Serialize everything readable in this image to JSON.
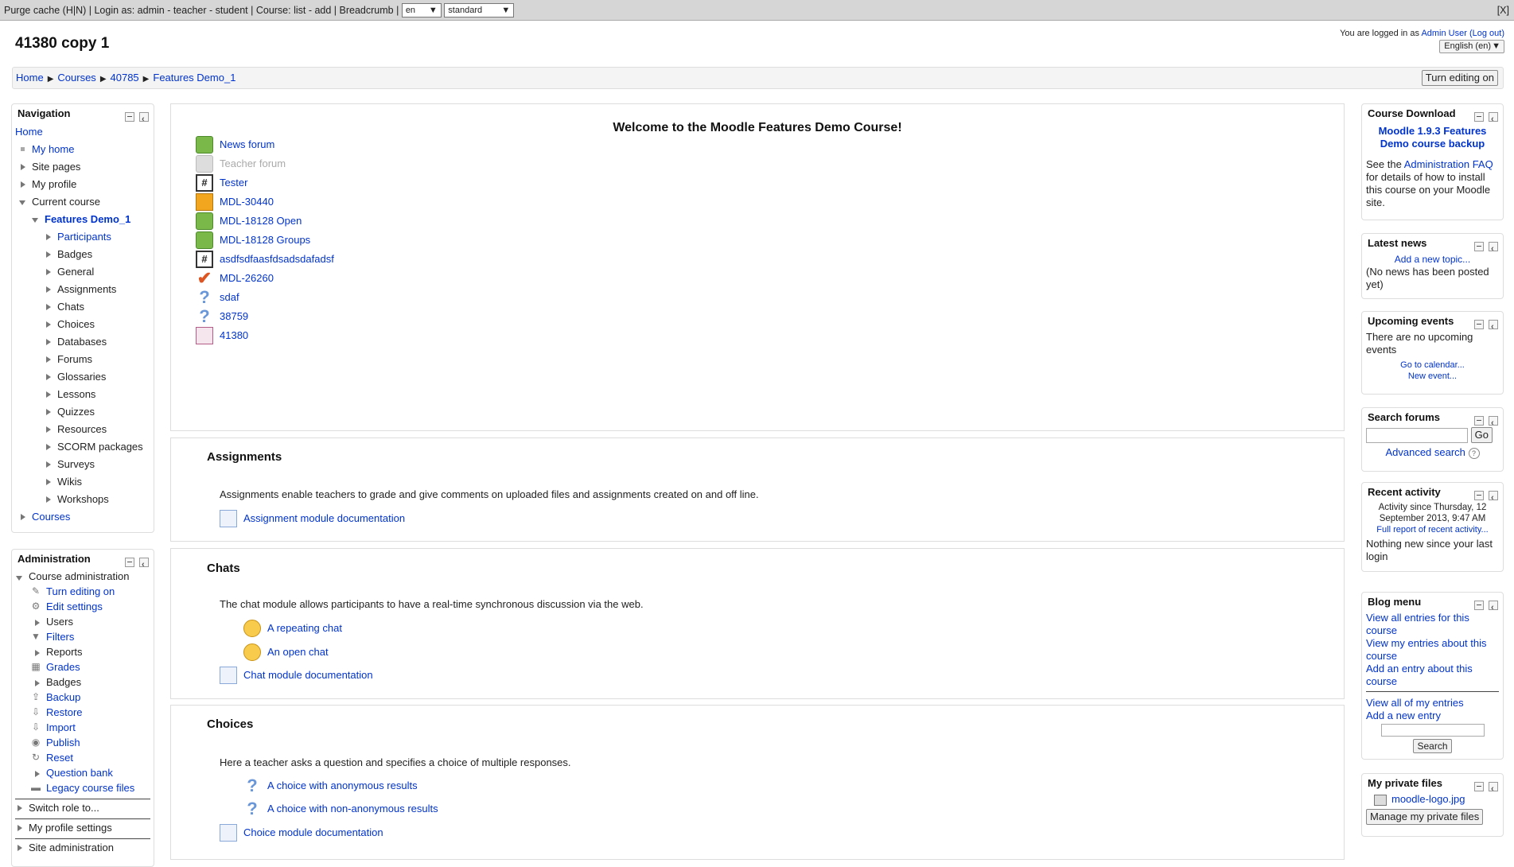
{
  "devbar": {
    "text": "Purge cache (H|N) | Login as: admin - teacher - student | Course: list - add | Breadcrumb |",
    "lang_select": "en",
    "theme_select": "standard",
    "close": "[X]"
  },
  "header": {
    "title": "41380 copy 1",
    "logged_in_prefix": "You are logged in as",
    "user": "Admin User",
    "logout": "(Log out)",
    "language": "English (en)"
  },
  "breadcrumb": [
    "Home",
    "Courses",
    "40785",
    "Features Demo_1"
  ],
  "edit_button": "Turn editing on",
  "navigation": {
    "title": "Navigation",
    "home": "Home",
    "items": [
      "My home",
      "Site pages",
      "My profile",
      "Current course"
    ],
    "course": "Features Demo_1",
    "course_items": [
      "Participants",
      "Badges",
      "General",
      "Assignments",
      "Chats",
      "Choices",
      "Databases",
      "Forums",
      "Glossaries",
      "Lessons",
      "Quizzes",
      "Resources",
      "SCORM packages",
      "Surveys",
      "Wikis",
      "Workshops"
    ],
    "courses": "Courses"
  },
  "administration": {
    "title": "Administration",
    "course_admin": "Course administration",
    "items": [
      {
        "label": "Turn editing on",
        "icon": "pencil-icon",
        "link": true
      },
      {
        "label": "Edit settings",
        "icon": "gear-icon",
        "link": true
      },
      {
        "label": "Users",
        "icon": "",
        "link": false
      },
      {
        "label": "Filters",
        "icon": "filter-icon",
        "link": true
      },
      {
        "label": "Reports",
        "icon": "",
        "link": false
      },
      {
        "label": "Grades",
        "icon": "grades-icon",
        "link": true
      },
      {
        "label": "Badges",
        "icon": "",
        "link": false
      },
      {
        "label": "Backup",
        "icon": "backup-icon",
        "link": true
      },
      {
        "label": "Restore",
        "icon": "restore-icon",
        "link": true
      },
      {
        "label": "Import",
        "icon": "import-icon",
        "link": true
      },
      {
        "label": "Publish",
        "icon": "publish-icon",
        "link": true
      },
      {
        "label": "Reset",
        "icon": "reset-icon",
        "link": true
      },
      {
        "label": "Question bank",
        "icon": "",
        "link": true
      },
      {
        "label": "Legacy course files",
        "icon": "folder-icon",
        "link": true
      }
    ],
    "switch_role": "Switch role to...",
    "profile_settings": "My profile settings",
    "site_admin": "Site administration"
  },
  "main": {
    "welcome": "Welcome to the Moodle Features Demo Course!",
    "activities": [
      {
        "label": "News forum",
        "icon": "forum-icon",
        "dim": false
      },
      {
        "label": "Teacher forum",
        "icon": "forum-icon",
        "dim": true
      },
      {
        "label": "Tester",
        "icon": "tester-icon",
        "dim": false
      },
      {
        "label": "MDL-30440",
        "icon": "package-icon",
        "dim": false
      },
      {
        "label": "MDL-18128 Open",
        "icon": "forum-icon",
        "dim": false
      },
      {
        "label": "MDL-18128 Groups",
        "icon": "forum-icon",
        "dim": false
      },
      {
        "label": "asdfsdfaasfdsadsdafadsf",
        "icon": "tester-icon",
        "dim": false
      },
      {
        "label": "MDL-26260",
        "icon": "checkmark-icon",
        "dim": false
      },
      {
        "label": "sdaf",
        "icon": "question-icon",
        "dim": false
      },
      {
        "label": "38759",
        "icon": "question-icon",
        "dim": false
      },
      {
        "label": "41380",
        "icon": "image-icon",
        "dim": false
      }
    ],
    "assignments": {
      "title": "Assignments",
      "summary": "Assignments enable teachers to grade and give comments on uploaded files and assignments created on and off line.",
      "doc": "Assignment module documentation"
    },
    "chats": {
      "title": "Chats",
      "summary": "The chat module allows participants to have a real-time synchronous discussion via the web.",
      "items": [
        "A repeating chat",
        "An open chat"
      ],
      "doc": "Chat module documentation"
    },
    "choices": {
      "title": "Choices",
      "summary": "Here a teacher asks a question and specifies a choice of multiple responses.",
      "items": [
        "A choice with anonymous results",
        "A choice with non-anonymous results"
      ],
      "doc": "Choice module documentation"
    }
  },
  "right": {
    "download": {
      "title": "Course Download",
      "link": "Moodle 1.9.3 Features Demo course backup",
      "text_pre": "See the",
      "faq": "Administration FAQ",
      "text_post": "for details of how to install this course on your Moodle site."
    },
    "news": {
      "title": "Latest news",
      "add": "Add a new topic...",
      "none": "(No news has been posted yet)"
    },
    "events": {
      "title": "Upcoming events",
      "none": "There are no upcoming events",
      "calendar": "Go to calendar...",
      "new": "New event..."
    },
    "search": {
      "title": "Search forums",
      "go": "Go",
      "advanced": "Advanced search"
    },
    "recent": {
      "title": "Recent activity",
      "since": "Activity since Thursday, 12 September 2013, 9:47 AM",
      "full": "Full report of recent activity...",
      "none": "Nothing new since your last login"
    },
    "blog": {
      "title": "Blog menu",
      "items": [
        "View all entries for this course",
        "View my entries about this course",
        "Add an entry about this course"
      ],
      "items2": [
        "View all of my entries",
        "Add a new entry"
      ],
      "search": "Search"
    },
    "files": {
      "title": "My private files",
      "file": "moodle-logo.jpg",
      "manage": "Manage my private files"
    }
  }
}
